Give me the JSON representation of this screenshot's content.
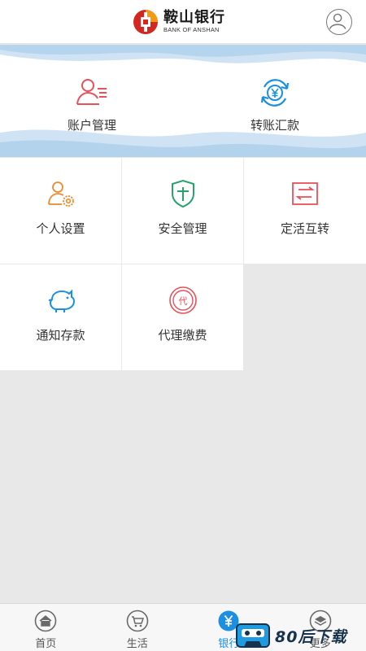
{
  "header": {
    "bank_name_cn": "鞍山银行",
    "bank_name_en": "BANK OF ANSHAN",
    "logo_icon": "bank-logo",
    "profile_icon": "user-icon"
  },
  "banner": {
    "items": [
      {
        "label": "账户管理",
        "icon": "account-user-icon",
        "color": "#e8515a"
      },
      {
        "label": "转账汇款",
        "icon": "yuan-transfer-icon",
        "color": "#1c8fe0"
      }
    ]
  },
  "grid": {
    "items": [
      {
        "label": "个人设置",
        "icon": "user-settings-icon",
        "color": "#f08a2c"
      },
      {
        "label": "安全管理",
        "icon": "shield-icon",
        "color": "#27a26a"
      },
      {
        "label": "定活互转",
        "icon": "transfer-card-icon",
        "color": "#e8515a"
      },
      {
        "label": "通知存款",
        "icon": "piggy-bank-icon",
        "color": "#1c8fe0"
      },
      {
        "label": "代理缴费",
        "icon": "agent-payment-icon",
        "color": "#e8515a"
      }
    ]
  },
  "tabbar": {
    "active_index": 2,
    "active_color": "#1c8fe0",
    "tabs": [
      {
        "label": "首页",
        "icon": "home-icon"
      },
      {
        "label": "生活",
        "icon": "cart-icon"
      },
      {
        "label": "银行",
        "icon": "yuan-icon"
      },
      {
        "label": "更多",
        "icon": "layers-icon"
      }
    ]
  },
  "watermark": {
    "text": "80后下载",
    "icon": "cassette-icon"
  }
}
